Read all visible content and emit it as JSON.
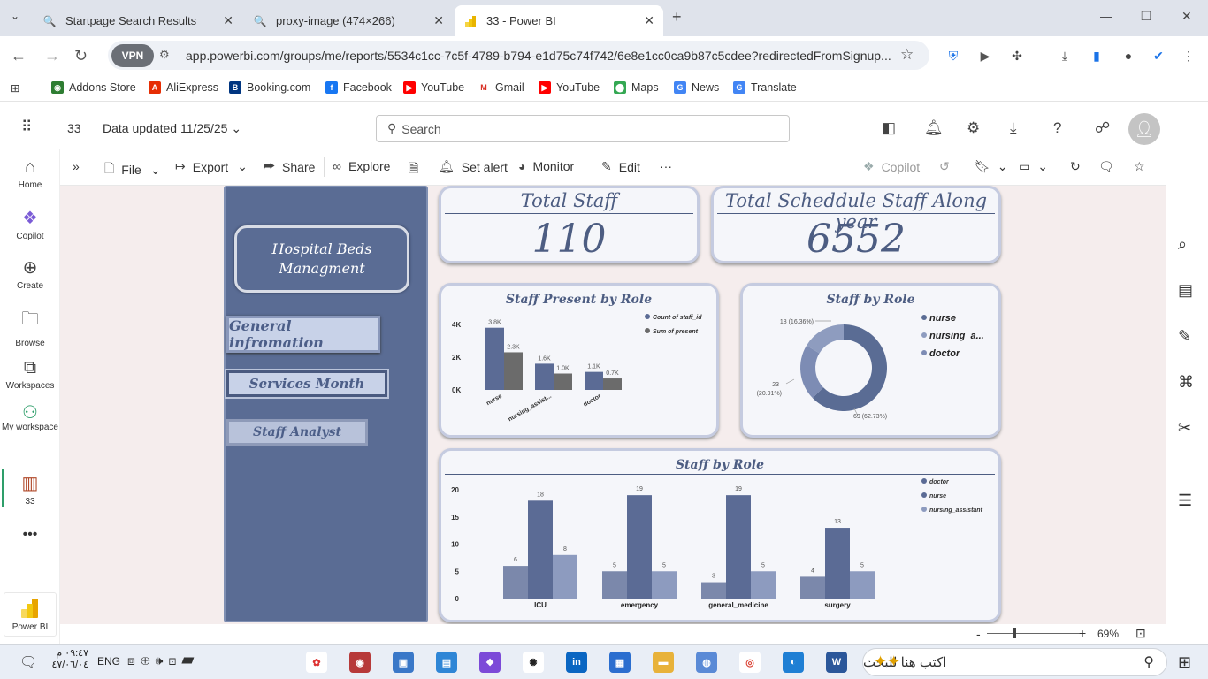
{
  "browser": {
    "tabs": [
      {
        "title": "Startpage Search Results",
        "icon": "search-icon"
      },
      {
        "title": "proxy-image (474×266)",
        "icon": "search-icon"
      },
      {
        "title": "33 - Power BI",
        "icon": "powerbi-icon"
      }
    ],
    "vpn_label": "VPN",
    "url": "app.powerbi.com/groups/me/reports/5534c1cc-7c5f-4789-b794-e1d75c74f742/6e8e1cc0ca9b87c5cdee?redirectedFromSignup...",
    "bookmarks": [
      "Addons Store",
      "AliExpress",
      "Booking.com",
      "Facebook",
      "YouTube",
      "Gmail",
      "YouTube",
      "Maps",
      "News",
      "Translate"
    ]
  },
  "pbi": {
    "report_name": "33",
    "data_updated": "Data updated 11/25/25",
    "search_placeholder": "Search",
    "rail": [
      "Home",
      "Copilot",
      "Create",
      "Browse",
      "Workspaces",
      "My workspace",
      "33"
    ],
    "app_name": "Power BI",
    "toolbar": {
      "file": "File",
      "export": "Export",
      "share": "Share",
      "explore": "Explore",
      "set_alert": "Set alert",
      "monitor": "Monitor",
      "edit": "Edit",
      "copilot": "Copilot"
    },
    "zoom": "69%"
  },
  "report": {
    "title": "Hospital Beds Managment",
    "nav_buttons": [
      "General infromation",
      "Services Month",
      "Staff Analyst"
    ],
    "kpis": [
      {
        "title": "Total Staff",
        "value": "110"
      },
      {
        "title": "Total Scheddule Staff Along year",
        "value": "6552"
      }
    ]
  },
  "colors": {
    "dark_blue": "#5a6c94",
    "bar_blue": "#5b6b95",
    "bar_grey": "#6b6b6b",
    "bar_light": "#8e9cbf",
    "donut_mid": "#7d8cb4"
  },
  "chart_data": [
    {
      "type": "bar",
      "title": "Staff Present by Role",
      "categories": [
        "nurse",
        "nursing_assist...",
        "doctor"
      ],
      "series": [
        {
          "name": "Count of staff_id",
          "values": [
            3.8,
            1.6,
            1.1
          ],
          "labels": [
            "3.8K",
            "1.6K",
            "1.1K"
          ]
        },
        {
          "name": "Sum of present",
          "values": [
            2.3,
            1.0,
            0.7
          ],
          "labels": [
            "2.3K",
            "1.0K",
            "0.7K"
          ]
        }
      ],
      "yticks": [
        "4K",
        "2K",
        "0K"
      ],
      "ylim": [
        0,
        4
      ],
      "legend": "top-right"
    },
    {
      "type": "pie",
      "title": "Staff by Role",
      "slices": [
        {
          "name": "nurse",
          "value": 69,
          "label": "69 (62.73%)"
        },
        {
          "name": "nursing_a...",
          "value": 23,
          "label_top": "23",
          "label_bottom": "(20.91%)"
        },
        {
          "name": "doctor",
          "value": 18,
          "label": "18 (16.36%)"
        }
      ],
      "legend": "right"
    },
    {
      "type": "bar",
      "title": "Staff by Role",
      "categories": [
        "ICU",
        "emergency",
        "general_medicine",
        "surgery"
      ],
      "series": [
        {
          "name": "doctor",
          "values": [
            6,
            5,
            3,
            4
          ]
        },
        {
          "name": "nurse",
          "values": [
            18,
            19,
            19,
            13
          ]
        },
        {
          "name": "nursing_assistant",
          "values": [
            8,
            5,
            5,
            5
          ]
        }
      ],
      "yticks": [
        "20",
        "15",
        "10",
        "5",
        "0"
      ],
      "ylim": [
        0,
        20
      ],
      "legend": "top-right"
    }
  ],
  "taskbar": {
    "time": "٠٩:٤٧ م",
    "date": "٤٧/٠٦/٠٤",
    "lang": "ENG",
    "search_placeholder": "اكتب هنا للبحث"
  }
}
